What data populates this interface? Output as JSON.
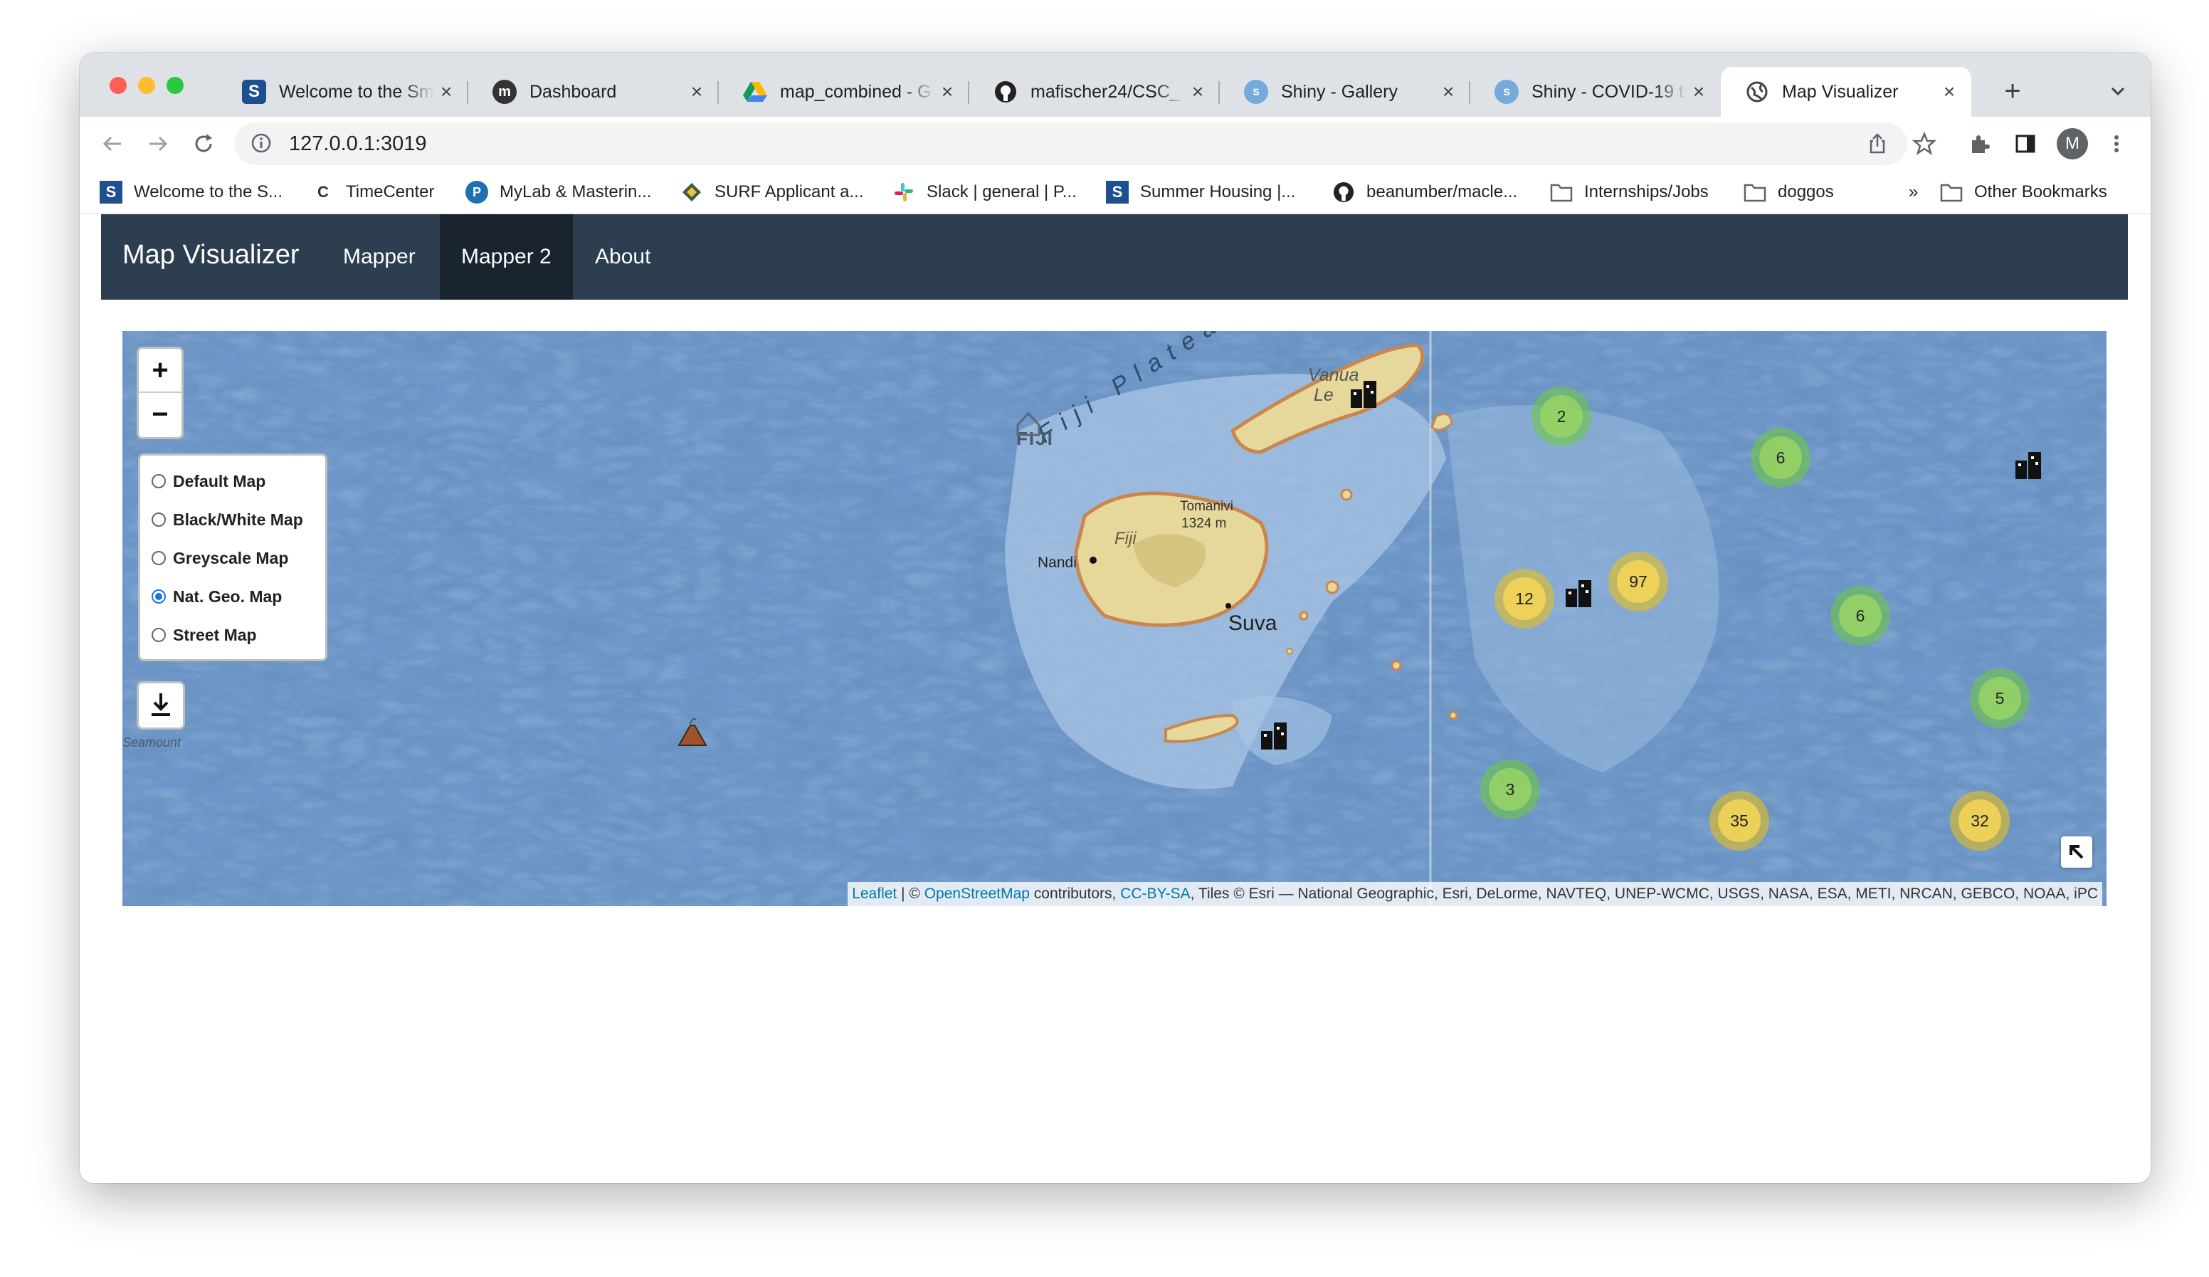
{
  "browser": {
    "tabs": [
      {
        "title": "Welcome to the Sm",
        "favicon": "smith-s-icon",
        "active": false
      },
      {
        "title": "Dashboard",
        "favicon": "moodle-icon",
        "active": false
      },
      {
        "title": "map_combined - G",
        "favicon": "google-drive-icon",
        "active": false
      },
      {
        "title": "mafischer24/CSC_",
        "favicon": "github-icon",
        "active": false
      },
      {
        "title": "Shiny - Gallery",
        "favicon": "shiny-icon",
        "active": false
      },
      {
        "title": "Shiny - COVID-19 t",
        "favicon": "shiny-icon",
        "active": false
      },
      {
        "title": "Map Visualizer",
        "favicon": "globe-icon",
        "active": true
      }
    ],
    "url": "127.0.0.1:3019",
    "profile_initial": "M",
    "bookmarks": [
      {
        "label": "Welcome to the S...",
        "icon": "smith-s-icon"
      },
      {
        "label": "TimeCenter",
        "icon": "timecenter-icon"
      },
      {
        "label": "MyLab & Masterin...",
        "icon": "pearson-icon"
      },
      {
        "label": "SURF Applicant a...",
        "icon": "surf-icon"
      },
      {
        "label": "Slack | general | P...",
        "icon": "slack-icon"
      },
      {
        "label": "Summer Housing |...",
        "icon": "smith-s-icon"
      },
      {
        "label": "beanumber/macle...",
        "icon": "github-icon"
      },
      {
        "label": "Internships/Jobs",
        "icon": "folder-icon"
      },
      {
        "label": "doggos",
        "icon": "folder-icon"
      }
    ],
    "bookmarks_overflow": "»",
    "other_bookmarks": "Other Bookmarks"
  },
  "app": {
    "brand": "Map Visualizer",
    "nav": [
      {
        "label": "Mapper",
        "active": false
      },
      {
        "label": "Mapper 2",
        "active": true
      },
      {
        "label": "About",
        "active": false
      }
    ]
  },
  "map": {
    "zoom_in": "+",
    "zoom_out": "−",
    "layers": [
      {
        "label": "Default Map",
        "selected": false
      },
      {
        "label": "Black/White Map",
        "selected": false
      },
      {
        "label": "Greyscale Map",
        "selected": false
      },
      {
        "label": "Nat. Geo. Map",
        "selected": true
      },
      {
        "label": "Street Map",
        "selected": false
      }
    ],
    "clusters": [
      {
        "count": "2",
        "color": "green"
      },
      {
        "count": "6",
        "color": "green"
      },
      {
        "count": "12",
        "color": "yellow"
      },
      {
        "count": "97",
        "color": "yellow"
      },
      {
        "count": "6",
        "color": "green"
      },
      {
        "count": "5",
        "color": "green"
      },
      {
        "count": "3",
        "color": "green"
      },
      {
        "count": "35",
        "color": "yellow"
      },
      {
        "count": "32",
        "color": "yellow"
      }
    ],
    "labels": {
      "fiji_plateau": "Fiji Plateau",
      "fiji_upper": "FIJI",
      "fiji_island": "Fiji",
      "vanua_levu_1": "Vanua",
      "vanua_levu_2": "Le",
      "tomanivi": "Tomanivi",
      "tomanivi_elev": "1324 m",
      "nandi": "Nandi",
      "suva": "Suva",
      "seamount": "Seamount"
    },
    "attribution": {
      "leaflet": "Leaflet",
      "sep": " | © ",
      "osm": "OpenStreetMap",
      "contrib": " contributors, ",
      "license": "CC-BY-SA",
      "tiles": ", Tiles © Esri — National Geographic, Esri, DeLorme, NAVTEQ, UNEP-WCMC, USGS, NASA, ESA, METI, NRCAN, GEBCO, NOAA, iPC"
    },
    "colors": {
      "ocean": "#6f98c9",
      "shelf": "#a9c6e4",
      "land": "#e6d89a",
      "land_edge": "#c9864e",
      "cluster_green": "#96d264",
      "cluster_yellow": "#f1d357"
    }
  }
}
